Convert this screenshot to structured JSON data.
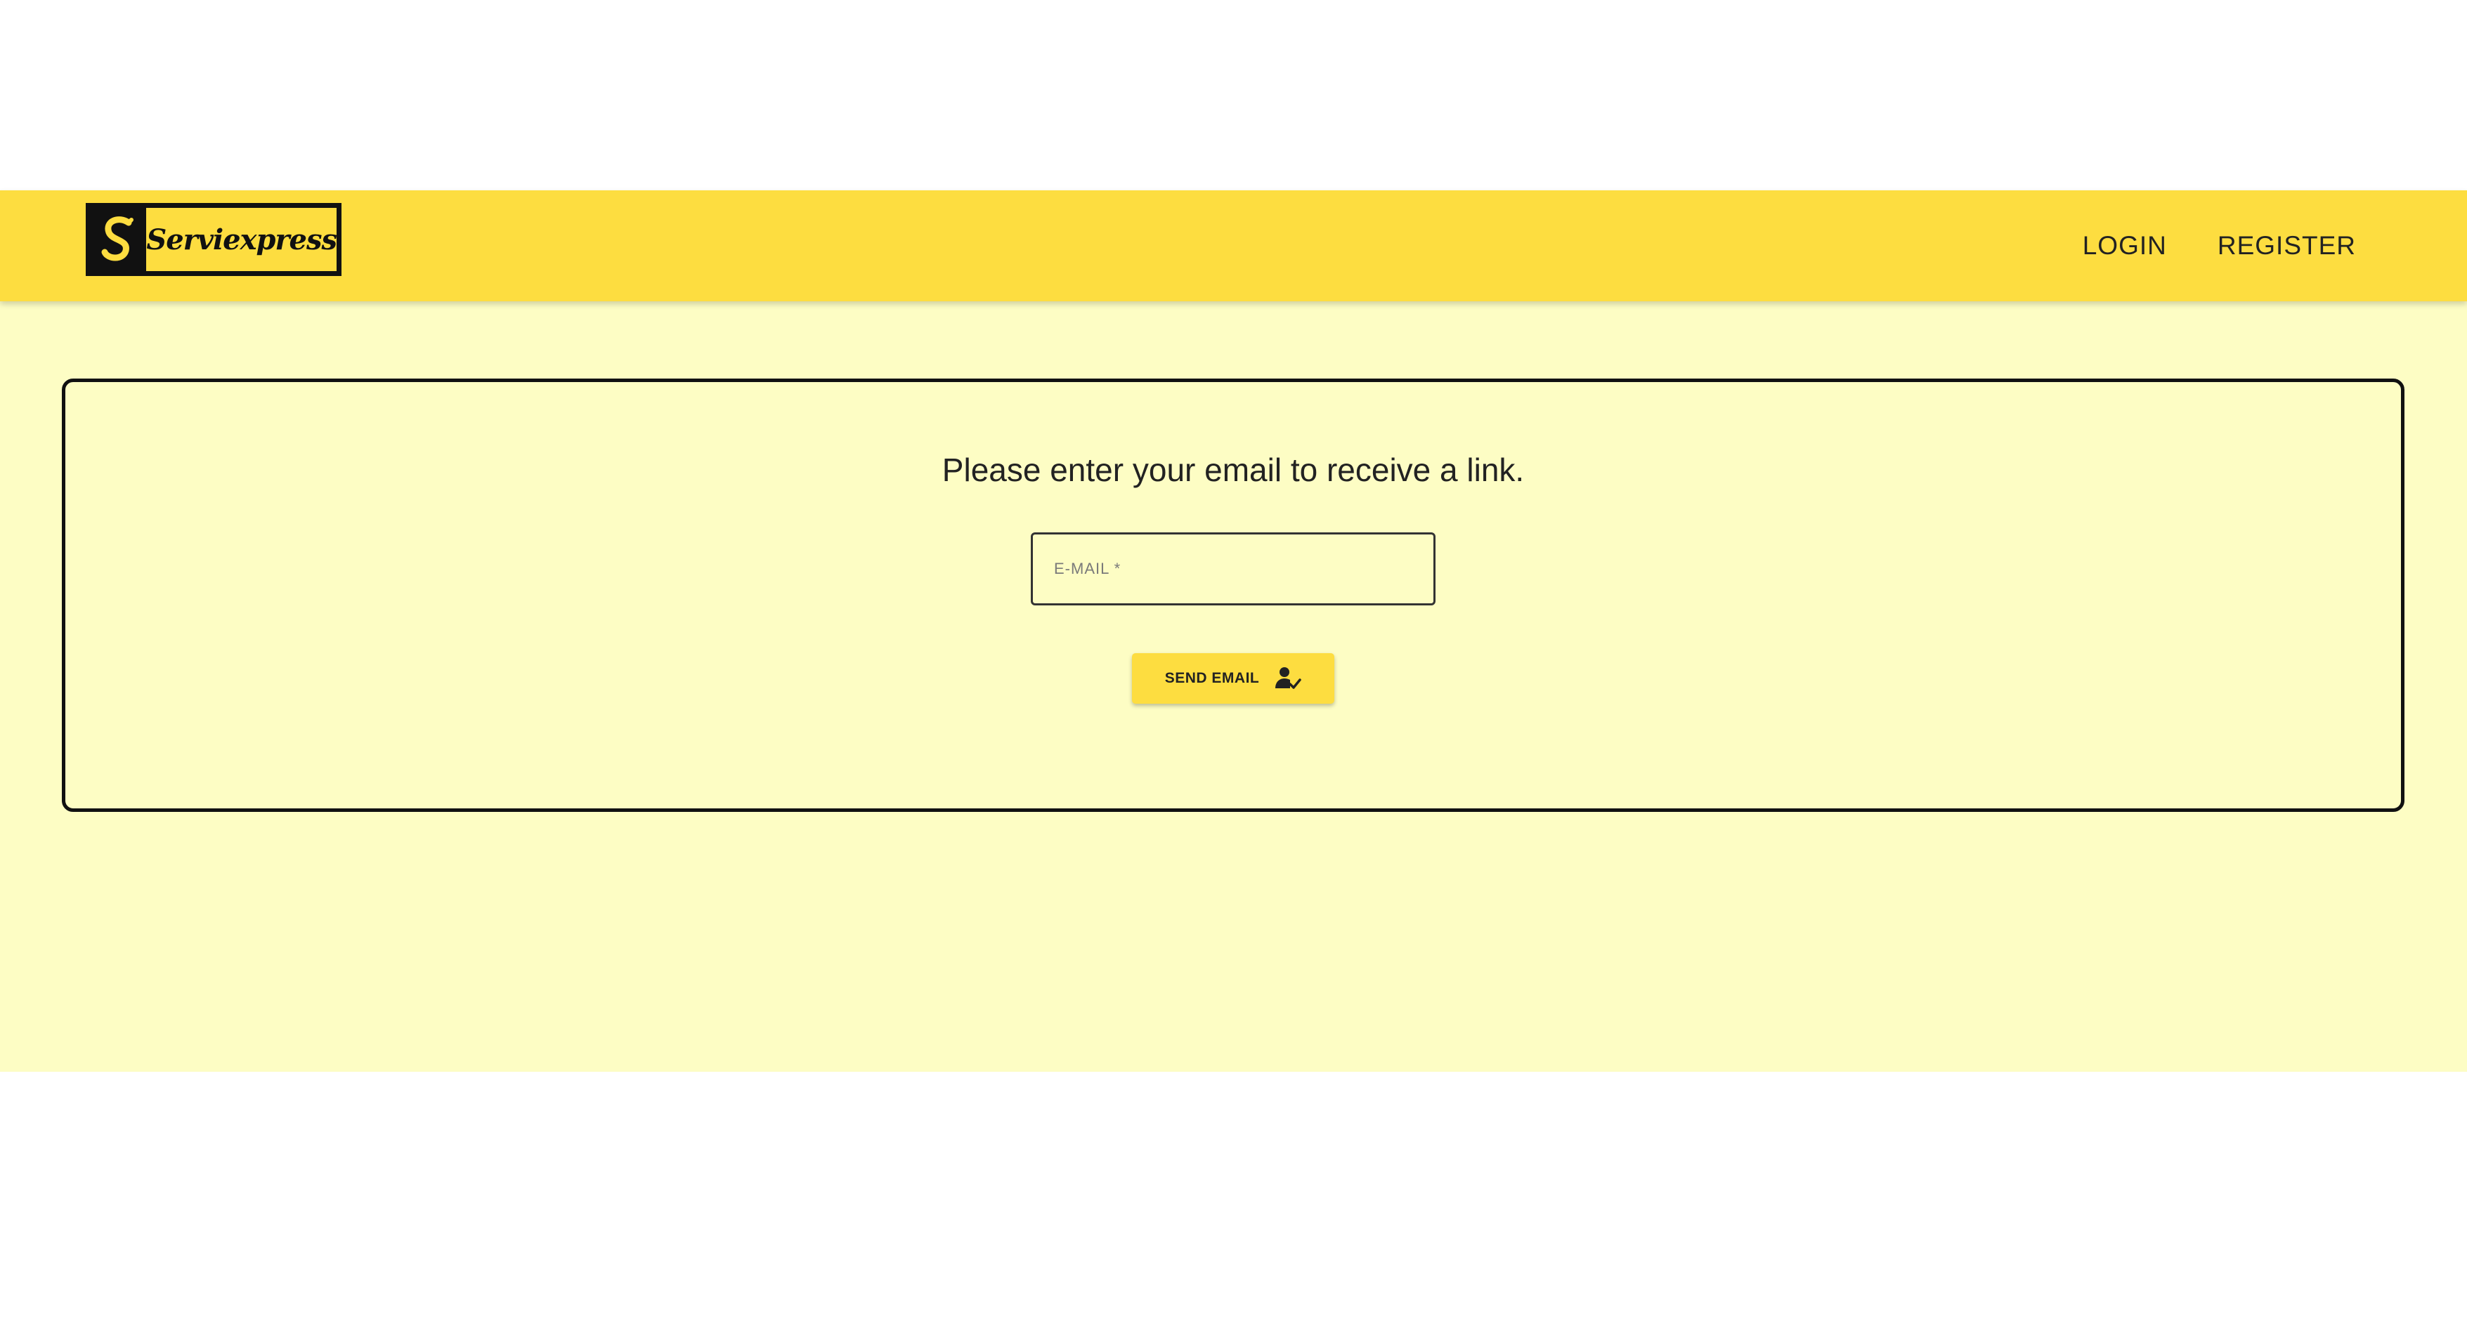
{
  "app": {
    "brand_name": "Serviexpress"
  },
  "nav": {
    "login_label": "LOGIN",
    "register_label": "REGISTER"
  },
  "reset_form": {
    "prompt": "Please enter your email to receive a link.",
    "email_placeholder": "E-MAIL *",
    "email_value": "",
    "send_button_label": "SEND EMAIL",
    "send_button_icon": "user-check-icon"
  },
  "colors": {
    "navbar": "#fddd40",
    "page_background": "#fdfdc4",
    "button": "#fddd40",
    "text": "#222222"
  }
}
